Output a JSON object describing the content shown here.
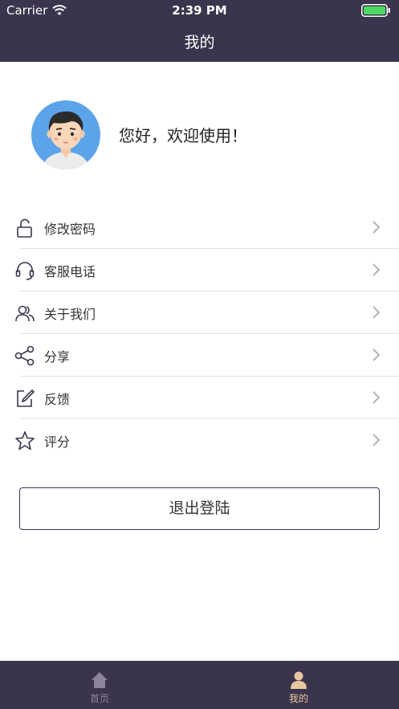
{
  "status_bar": {
    "carrier": "Carrier",
    "time": "2:39 PM",
    "battery_color": "#4cd964"
  },
  "nav": {
    "title": "我的"
  },
  "profile": {
    "greeting": "您好，欢迎使用！"
  },
  "menu": {
    "items": [
      {
        "label": "修改密码",
        "icon": "unlock-icon"
      },
      {
        "label": "客服电话",
        "icon": "headset-icon"
      },
      {
        "label": "关于我们",
        "icon": "users-icon"
      },
      {
        "label": "分享",
        "icon": "share-icon"
      },
      {
        "label": "反馈",
        "icon": "edit-icon"
      },
      {
        "label": "评分",
        "icon": "star-icon"
      }
    ]
  },
  "logout": {
    "label": "退出登陆"
  },
  "tabbar": {
    "tabs": [
      {
        "label": "首页",
        "icon": "home-icon",
        "selected": false
      },
      {
        "label": "我的",
        "icon": "person-icon",
        "selected": true
      }
    ]
  },
  "colors": {
    "header_bg": "#3b344d",
    "tab_inactive": "#8b849c",
    "tab_active": "#e8c7a0"
  }
}
